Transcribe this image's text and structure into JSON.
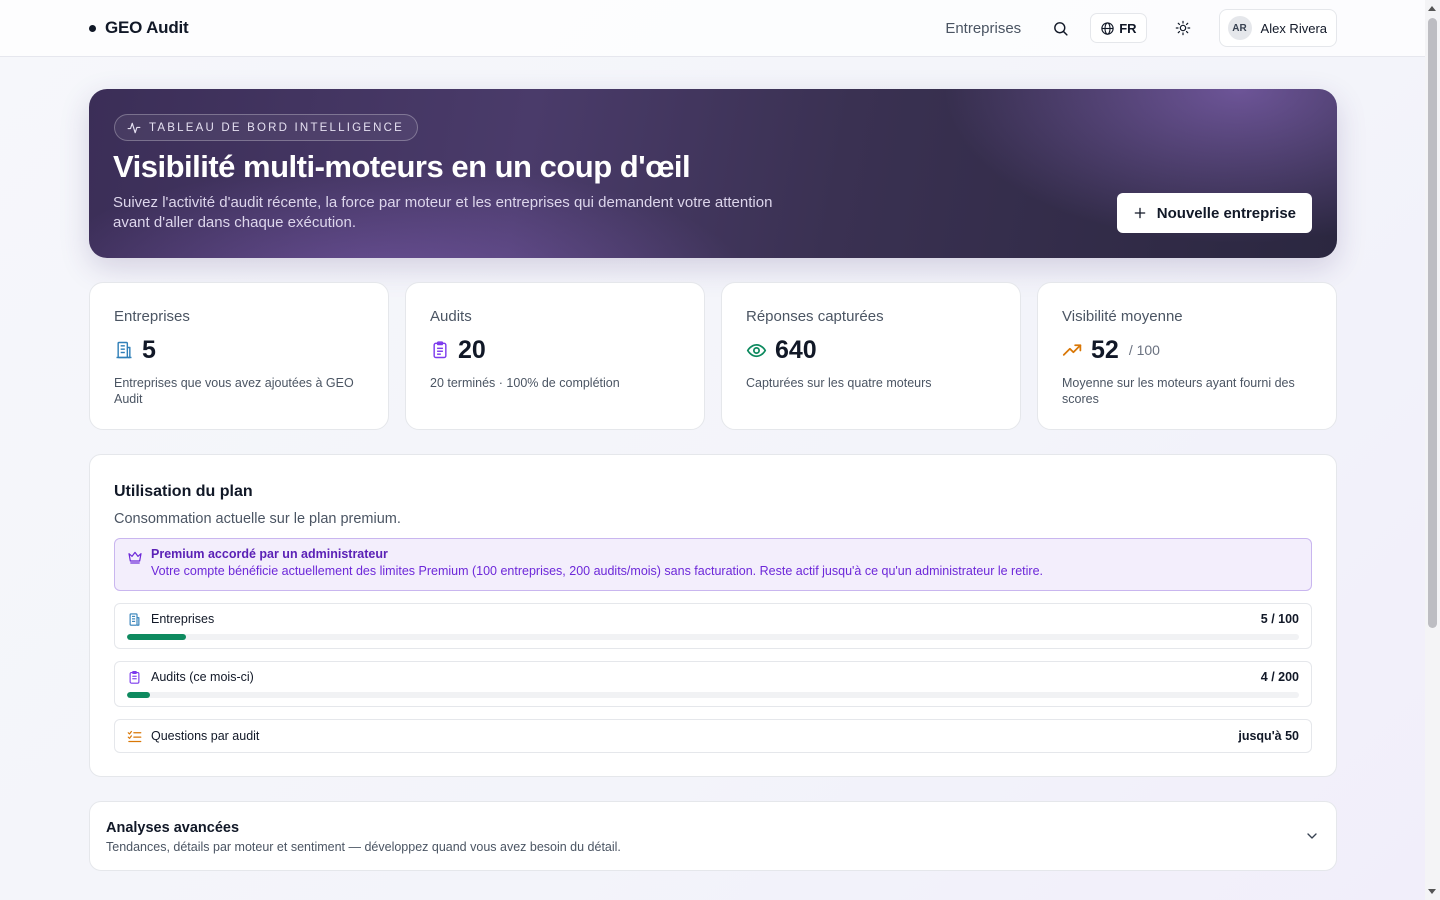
{
  "header": {
    "brand": "GEO Audit",
    "nav_link": "Entreprises",
    "lang": "FR",
    "user_initials": "AR",
    "user_name": "Alex Rivera"
  },
  "hero": {
    "badge": "TABLEAU DE BORD INTELLIGENCE",
    "title": "Visibilité multi-moteurs en un coup d'œil",
    "description": "Suivez l'activité d'audit récente, la force par moteur et les entreprises qui demandent votre attention avant d'aller dans chaque exécution.",
    "cta": "Nouvelle entreprise"
  },
  "stats": [
    {
      "label": "Entreprises",
      "value": "5",
      "suffix": "",
      "note": "Entreprises que vous avez ajoutées à GEO Audit",
      "icon": "building-icon",
      "color": "#2f7fb8"
    },
    {
      "label": "Audits",
      "value": "20",
      "suffix": "",
      "note": "20 terminés · 100% de complétion",
      "icon": "clipboard-icon",
      "color": "#7c3aed"
    },
    {
      "label": "Réponses capturées",
      "value": "640",
      "suffix": "",
      "note": "Capturées sur les quatre moteurs",
      "icon": "eye-icon",
      "color": "#0e8a5f"
    },
    {
      "label": "Visibilité moyenne",
      "value": "52",
      "suffix": "/ 100",
      "note": "Moyenne sur les moteurs ayant fourni des scores",
      "icon": "trending-up-icon",
      "color": "#d97706"
    }
  ],
  "plan": {
    "title": "Utilisation du plan",
    "subtitle": "Consommation actuelle sur le plan premium.",
    "premium_title": "Premium accordé par un administrateur",
    "premium_text": "Votre compte bénéficie actuellement des limites Premium (100 entreprises, 200 audits/mois) sans facturation. Reste actif jusqu'à ce qu'un administrateur le retire.",
    "usage": [
      {
        "label": "Entreprises",
        "value": "5 / 100",
        "fraction": 0.05
      },
      {
        "label": "Audits (ce mois-ci)",
        "value": "4 / 200",
        "fraction": 0.02
      },
      {
        "label": "Questions par audit",
        "value": "jusqu'à 50"
      }
    ]
  },
  "advanced": {
    "title": "Analyses avancées",
    "subtitle": "Tendances, détails par moteur et sentiment — développez quand vous avez besoin du détail."
  },
  "colors": {
    "accent_green": "#0e8a5f",
    "premium_purple": "#6d28d9"
  }
}
